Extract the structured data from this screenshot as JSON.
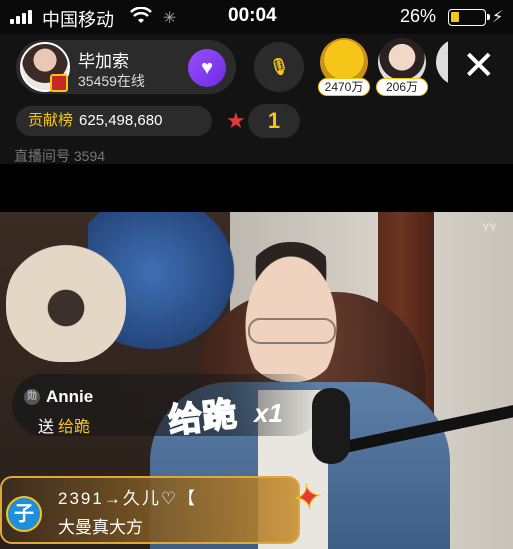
{
  "status_bar": {
    "carrier": "中国移动",
    "time": "00:04",
    "battery_percent_text": "26%",
    "battery_level": 0.26,
    "accent_color": "#f5c518"
  },
  "host": {
    "name": "毕加索",
    "online": "35459在线"
  },
  "viewers": [
    {
      "count": "2470万"
    },
    {
      "count": "206万"
    }
  ],
  "contribution": {
    "label": "贡献榜",
    "value": "625,498,680"
  },
  "rank": {
    "value": "1"
  },
  "room": {
    "id_text": "直播间号 3594"
  },
  "video": {
    "watermark": "YY"
  },
  "gift": {
    "user": "Annie",
    "verb": "送",
    "gift_name": "给跪",
    "art_text": "给跪",
    "combo": "x1"
  },
  "chat": {
    "badge": "子",
    "line1": "2391→久儿♡【",
    "line2": "大曼真大方"
  },
  "icons": {
    "follow": "heart-icon",
    "mic": "mic-link-icon",
    "close": "close-icon",
    "rank_star": "star-icon"
  }
}
